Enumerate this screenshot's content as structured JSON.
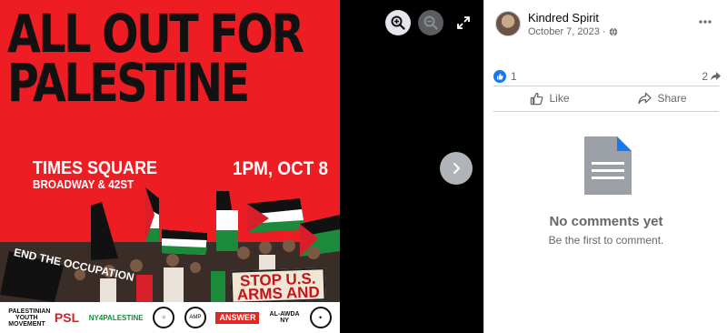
{
  "poster": {
    "headline_line1": "ALL OUT FOR",
    "headline_line2": "PALESTINE",
    "location_main": "TIMES SQUARE",
    "location_sub": "BROADWAY & 42ST",
    "time": "1PM, OCT 8",
    "sign_text": "STOP U.S. ARMS AND",
    "flag_text": "END THE OCCUPATION",
    "logos": [
      "PALESTINIAN YOUTH MOVEMENT",
      "PSL",
      "NY4PALESTINE",
      "AMP",
      "ANSWER",
      "AL-AWDA NY"
    ]
  },
  "viewer_controls": {
    "zoom_in_icon": "zoom-in-icon",
    "zoom_out_icon": "zoom-out-icon",
    "expand_icon": "expand-icon",
    "next_icon": "chevron-right-icon"
  },
  "post": {
    "author": "Kindred Spirit",
    "date": "October 7, 2023",
    "separator": "·",
    "privacy_icon": "globe-icon"
  },
  "reactions": {
    "like_count": "1",
    "share_count": "2"
  },
  "actions": {
    "like_label": "Like",
    "share_label": "Share"
  },
  "comments": {
    "empty_title": "No comments yet",
    "empty_subtitle": "Be the first to comment."
  },
  "colors": {
    "poster_red": "#ee1c23",
    "facebook_blue": "#1877f2",
    "doc_gray": "#9aa0a6"
  }
}
